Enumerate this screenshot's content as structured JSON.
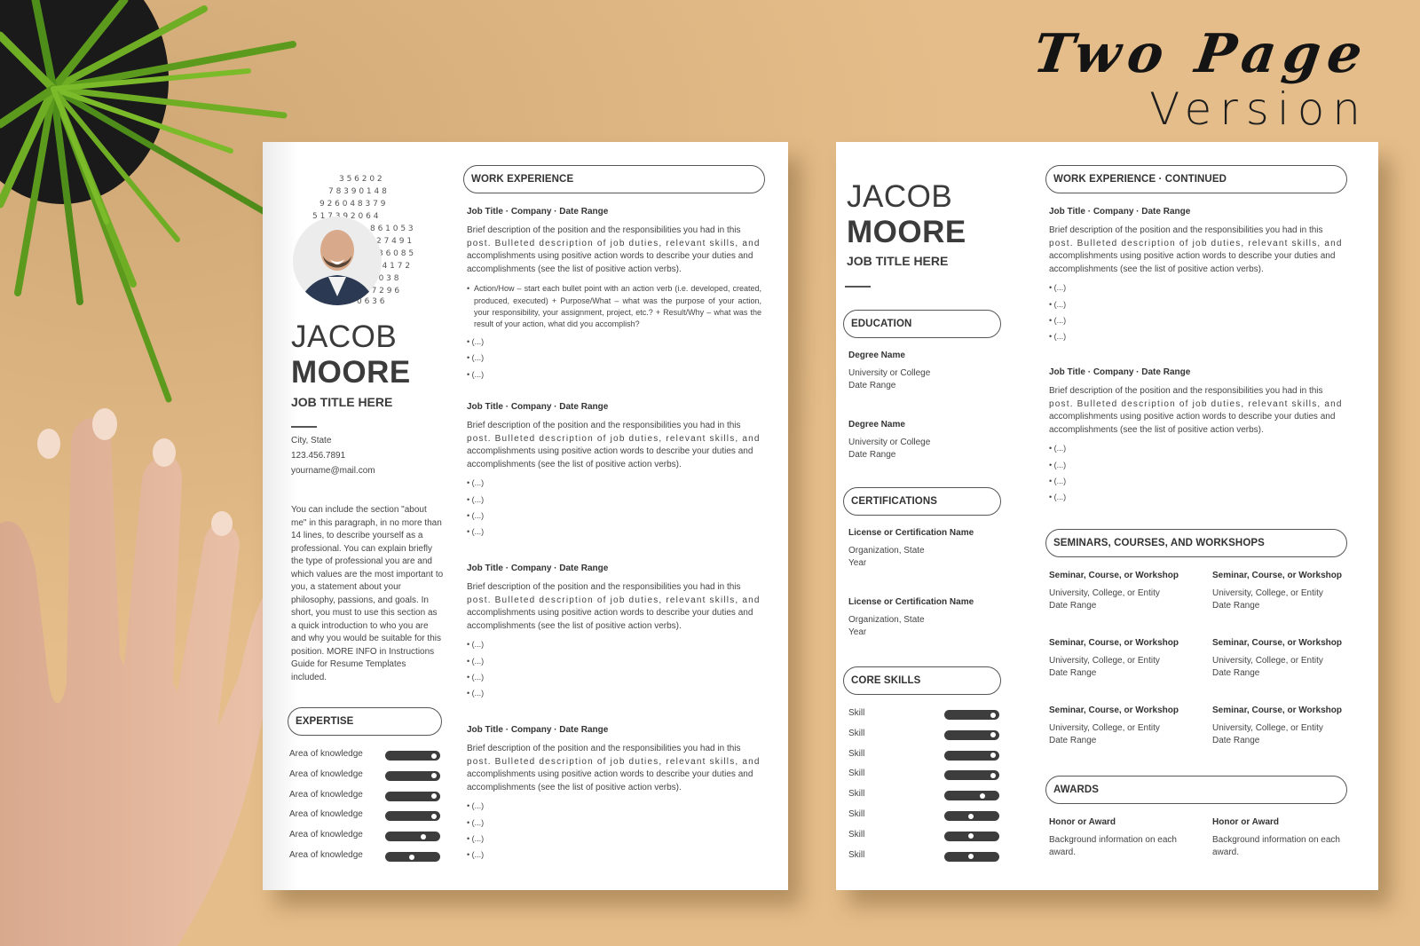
{
  "headline": {
    "line1": "Two Page",
    "line2": "Version"
  },
  "colors": {
    "background": "#e5bd8a",
    "page": "#ffffff",
    "text": "#3b3b3b",
    "bar": "#3d3d3d"
  },
  "resume": {
    "first_name": "JACOB",
    "last_name": "MOORE",
    "job_title": "JOB TITLE HERE",
    "contact": {
      "location": "City, State",
      "phone": "123.456.7891",
      "email": "yourname@mail.com"
    },
    "about": "You can include the section \"about me\" in this paragraph, in no more than 14 lines, to describe yourself as a professional. You can explain briefly the type of professional you are and which values are the most important to you, a statement about your philosophy, passions, and goals. In short, you must to use this section as a quick introduction to who you are and why you would be suitable for this position. MORE INFO in Instructions Guide for Resume Templates included.",
    "expertise": {
      "heading": "EXPERTISE",
      "items": [
        {
          "label": "Area of knowledge",
          "level": 1.0
        },
        {
          "label": "Area of knowledge",
          "level": 1.0
        },
        {
          "label": "Area of knowledge",
          "level": 1.0
        },
        {
          "label": "Area of knowledge",
          "level": 1.0
        },
        {
          "label": "Area of knowledge",
          "level": 0.75
        },
        {
          "label": "Area of knowledge",
          "level": 0.5
        }
      ]
    },
    "work_experience": {
      "heading": "WORK EXPERIENCE",
      "job_header": "Job Title · Company · Date Range",
      "description_line1": "Brief description of the position and the responsibilities you had in this",
      "description_line2": "post. Bulleted description of job duties, relevant skills, and",
      "description_line3": "accomplishments using positive action words to describe your duties and",
      "description_line4": "accomplishments (see the list of positive action verbs).",
      "action_bullet": "Action/How – start each bullet point with an action verb (i.e. developed, created, produced, executed) + Purpose/What – what was the purpose of your action, your responsibility, your assignment, project, etc.? + Result/Why – what was the result of your action, what did you accomplish?",
      "bullet": "• (...)"
    },
    "page2": {
      "work_heading": "WORK EXPERIENCE · CONTINUED",
      "education": {
        "heading": "EDUCATION",
        "items": [
          {
            "degree": "Degree Name",
            "school": "University or College",
            "date": "Date Range"
          },
          {
            "degree": "Degree Name",
            "school": "University or College",
            "date": "Date Range"
          }
        ]
      },
      "certifications": {
        "heading": "CERTIFICATIONS",
        "items": [
          {
            "name": "License or Certification Name",
            "org": "Organization, State",
            "year": "Year"
          },
          {
            "name": "License or Certification Name",
            "org": "Organization, State",
            "year": "Year"
          }
        ]
      },
      "core_skills": {
        "heading": "CORE SKILLS",
        "items": [
          {
            "label": "Skill",
            "level": 1.0
          },
          {
            "label": "Skill",
            "level": 1.0
          },
          {
            "label": "Skill",
            "level": 1.0
          },
          {
            "label": "Skill",
            "level": 1.0
          },
          {
            "label": "Skill",
            "level": 0.75
          },
          {
            "label": "Skill",
            "level": 0.5
          },
          {
            "label": "Skill",
            "level": 0.5
          },
          {
            "label": "Skill",
            "level": 0.5
          }
        ]
      },
      "seminars": {
        "heading": "SEMINARS, COURSES, AND WORKSHOPS",
        "items": [
          {
            "title": "Seminar, Course, or Workshop",
            "entity": "University, College, or Entity",
            "date": "Date Range"
          },
          {
            "title": "Seminar, Course, or Workshop",
            "entity": "University, College, or Entity",
            "date": "Date Range"
          },
          {
            "title": "Seminar, Course, or Workshop",
            "entity": "University, College, or Entity",
            "date": "Date Range"
          },
          {
            "title": "Seminar, Course, or Workshop",
            "entity": "University, College, or Entity",
            "date": "Date Range"
          },
          {
            "title": "Seminar, Course, or Workshop",
            "entity": "University, College, or Entity",
            "date": "Date Range"
          },
          {
            "title": "Seminar, Course, or Workshop",
            "entity": "University, College, or Entity",
            "date": "Date Range"
          }
        ]
      },
      "awards": {
        "heading": "AWARDS",
        "items": [
          {
            "title": "Honor or Award",
            "info": "Background information on each award."
          },
          {
            "title": "Honor or Award",
            "info": "Background information on each award."
          }
        ]
      }
    }
  }
}
